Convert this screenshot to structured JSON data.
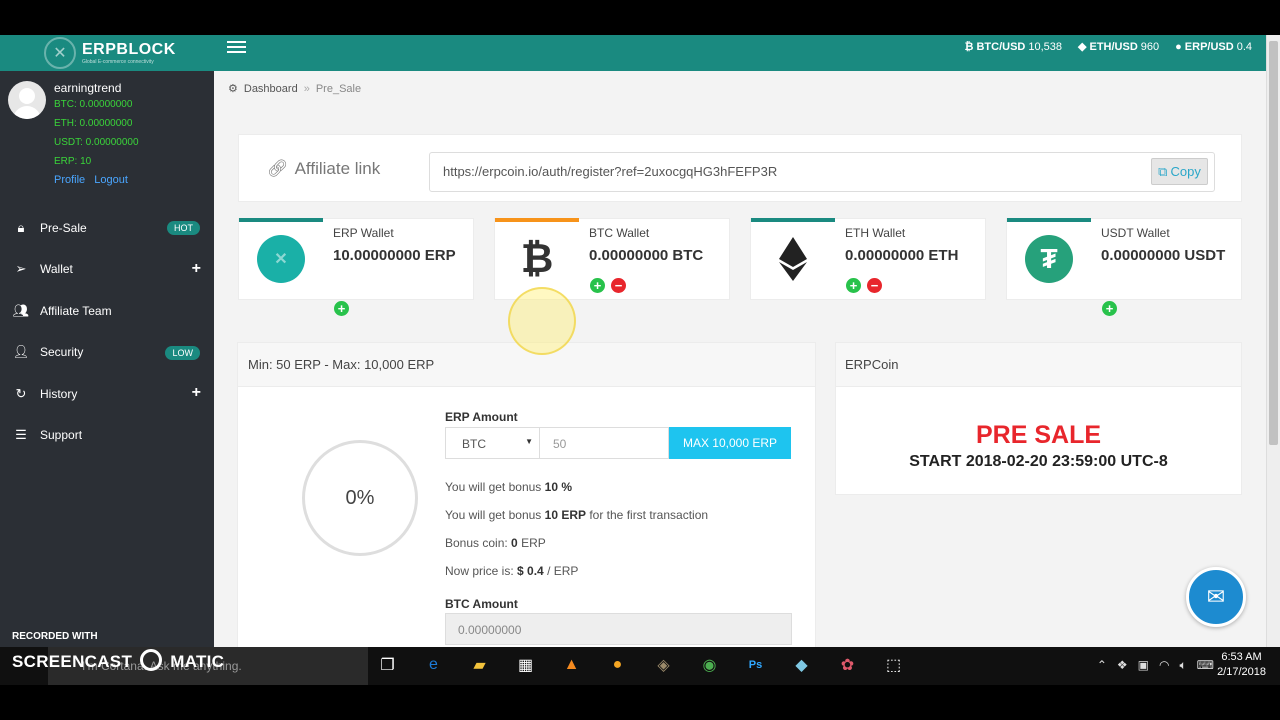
{
  "topbar": {
    "brand": "ERPBLOCK",
    "brand_sub": "Global E-commerce connectivity",
    "tickers": [
      {
        "label": "BTC/USD",
        "value": "10,538",
        "icon": "bitcoin-icon"
      },
      {
        "label": "ETH/USD",
        "value": "960",
        "icon": "ethereum-icon"
      },
      {
        "label": "ERP/USD",
        "value": "0.4",
        "icon": "erp-coin-icon"
      }
    ]
  },
  "profile": {
    "username": "earningtrend",
    "balances": [
      "BTC: 0.00000000",
      "ETH: 0.00000000",
      "USDT: 0.00000000",
      "ERP: 10"
    ],
    "profile_link": "Profile",
    "logout_link": "Logout"
  },
  "nav": [
    {
      "label": "Pre-Sale",
      "badge": "HOT",
      "icon": "lock-icon"
    },
    {
      "label": "Wallet",
      "icon": "paper-plane-icon"
    },
    {
      "label": "Affiliate Team",
      "icon": "team-icon"
    },
    {
      "label": "Security",
      "badge": "LOW",
      "icon": "user-icon"
    },
    {
      "label": "History",
      "icon": "refresh-icon"
    },
    {
      "label": "Support",
      "icon": "layers-icon"
    }
  ],
  "breadcrumb": {
    "home": "Dashboard",
    "current": "Pre_Sale"
  },
  "affiliate": {
    "title": "Affiliate link",
    "url": "https://erpcoin.io/auth/register?ref=2uxocgqHG3hFEFP3R",
    "copy_label": "Copy"
  },
  "wallets": [
    {
      "name": "ERP Wallet",
      "balance": "10.00000000 ERP",
      "accent": "#1a8a80"
    },
    {
      "name": "BTC Wallet",
      "balance": "0.00000000 BTC",
      "accent": "#f7931a"
    },
    {
      "name": "ETH Wallet",
      "balance": "0.00000000 ETH",
      "accent": "#1a8a80"
    },
    {
      "name": "USDT Wallet",
      "balance": "0.00000000 USDT",
      "accent": "#1a8a80"
    }
  ],
  "presale_form": {
    "header": "Min: 50 ERP - Max: 10,000 ERP",
    "progress": "0%",
    "erp_amount_label": "ERP Amount",
    "currency_selected": "BTC",
    "amount_value": "50",
    "max_button": "MAX 10,000 ERP",
    "bonus_line_prefix": "You will get bonus ",
    "bonus_pct": "10 %",
    "bonus_erp_prefix": "You will get bonus ",
    "bonus_erp": "10 ERP",
    "bonus_erp_suffix": " for the first transaction",
    "bonus_coin_prefix": "Bonus coin: ",
    "bonus_coin": "0",
    "bonus_coin_suffix": " ERP",
    "price_prefix": "Now price is: ",
    "price": "$ 0.4",
    "price_suffix": " / ERP",
    "btc_amount_label": "BTC Amount",
    "btc_amount_placeholder": "0.00000000"
  },
  "coin_info": {
    "header": "ERPCoin",
    "presale_title": "PRE SALE",
    "start": "START 2018-02-20 23:59:00 UTC-8"
  },
  "overlay": {
    "recorded_with": "RECORDED WITH",
    "screencast": "SCREENCAST",
    "matic": "MATIC"
  },
  "taskbar": {
    "search_placeholder": "I'm Cortana. Ask me anything.",
    "time": "6:53 AM",
    "date": "2/17/2018"
  },
  "colors": {
    "teal": "#1a8a80",
    "sidebar": "#2b2f35",
    "presale_red": "#e8262c",
    "max_button": "#1ec4ef"
  }
}
